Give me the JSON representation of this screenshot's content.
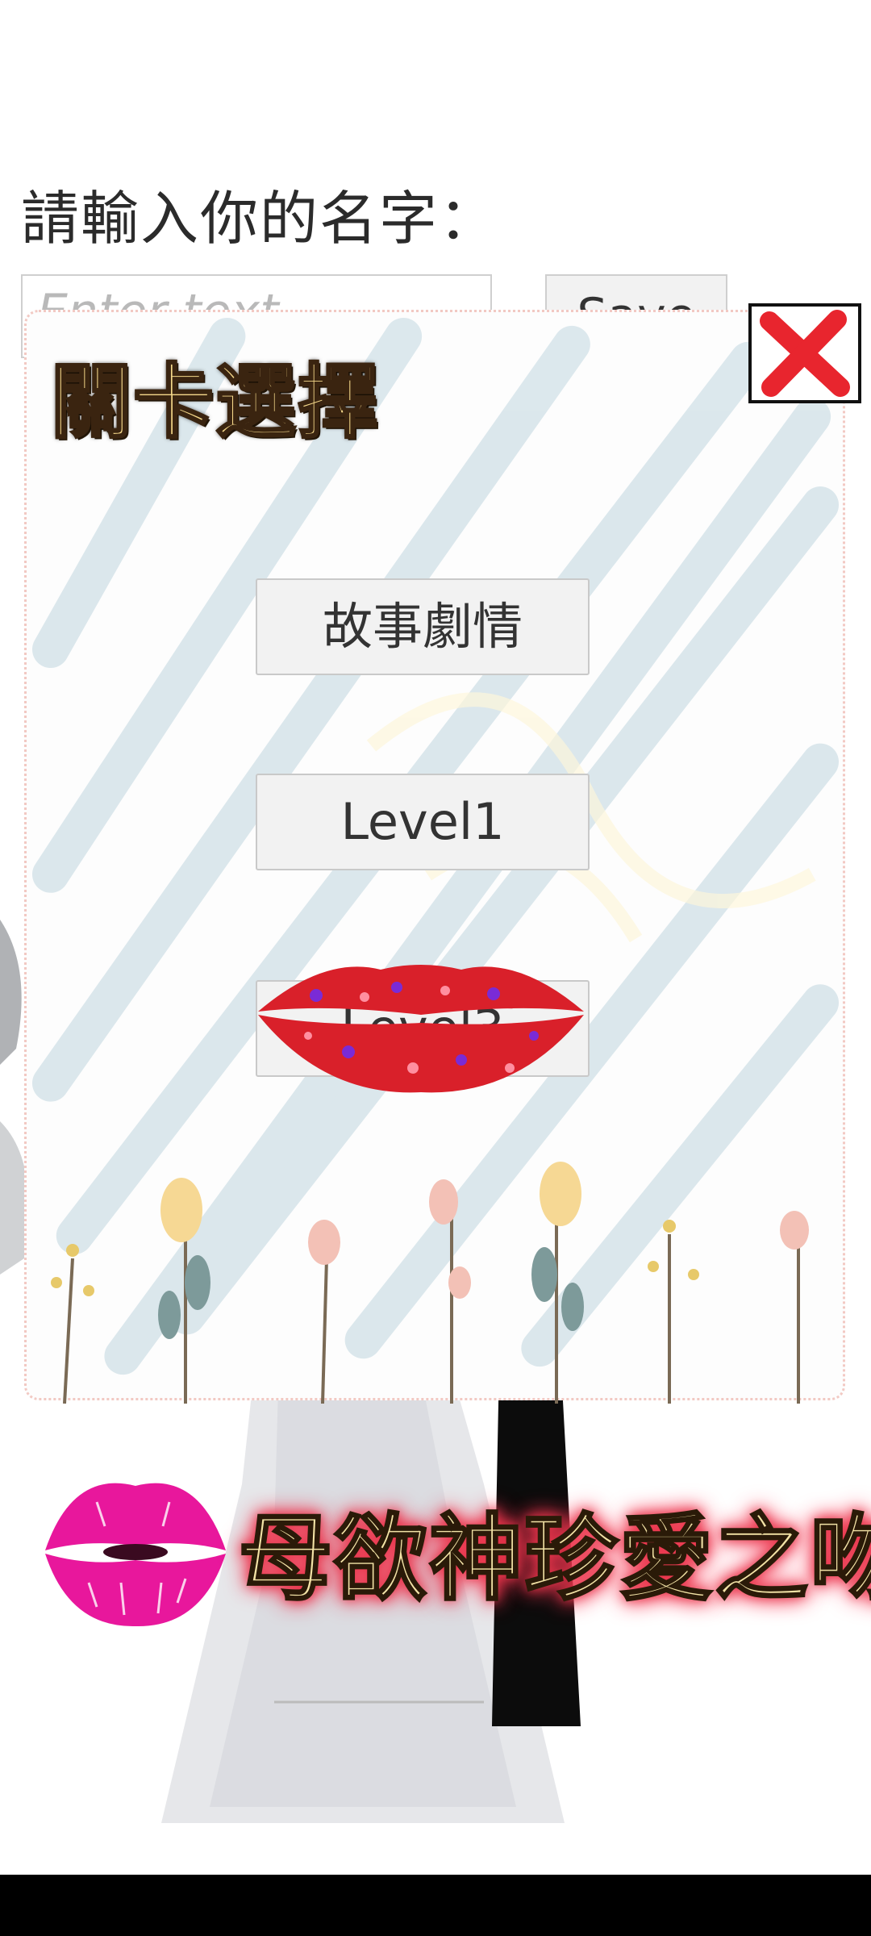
{
  "name_prompt": {
    "label": "請輸入你的名字：",
    "input_placeholder": "Enter text",
    "save_label": "Save"
  },
  "level_panel": {
    "title": "關卡選擇",
    "close_icon": "close-x-icon",
    "buttons": [
      {
        "label": "故事劇情"
      },
      {
        "label": "Level1"
      },
      {
        "label": "Level3"
      }
    ]
  },
  "game_title": "母欲神珍愛之吻",
  "colors": {
    "close_x": "#e8252e",
    "lips_red": "#d9202a",
    "pink_lips": "#e8179c",
    "title_glow": "#e8354b"
  }
}
